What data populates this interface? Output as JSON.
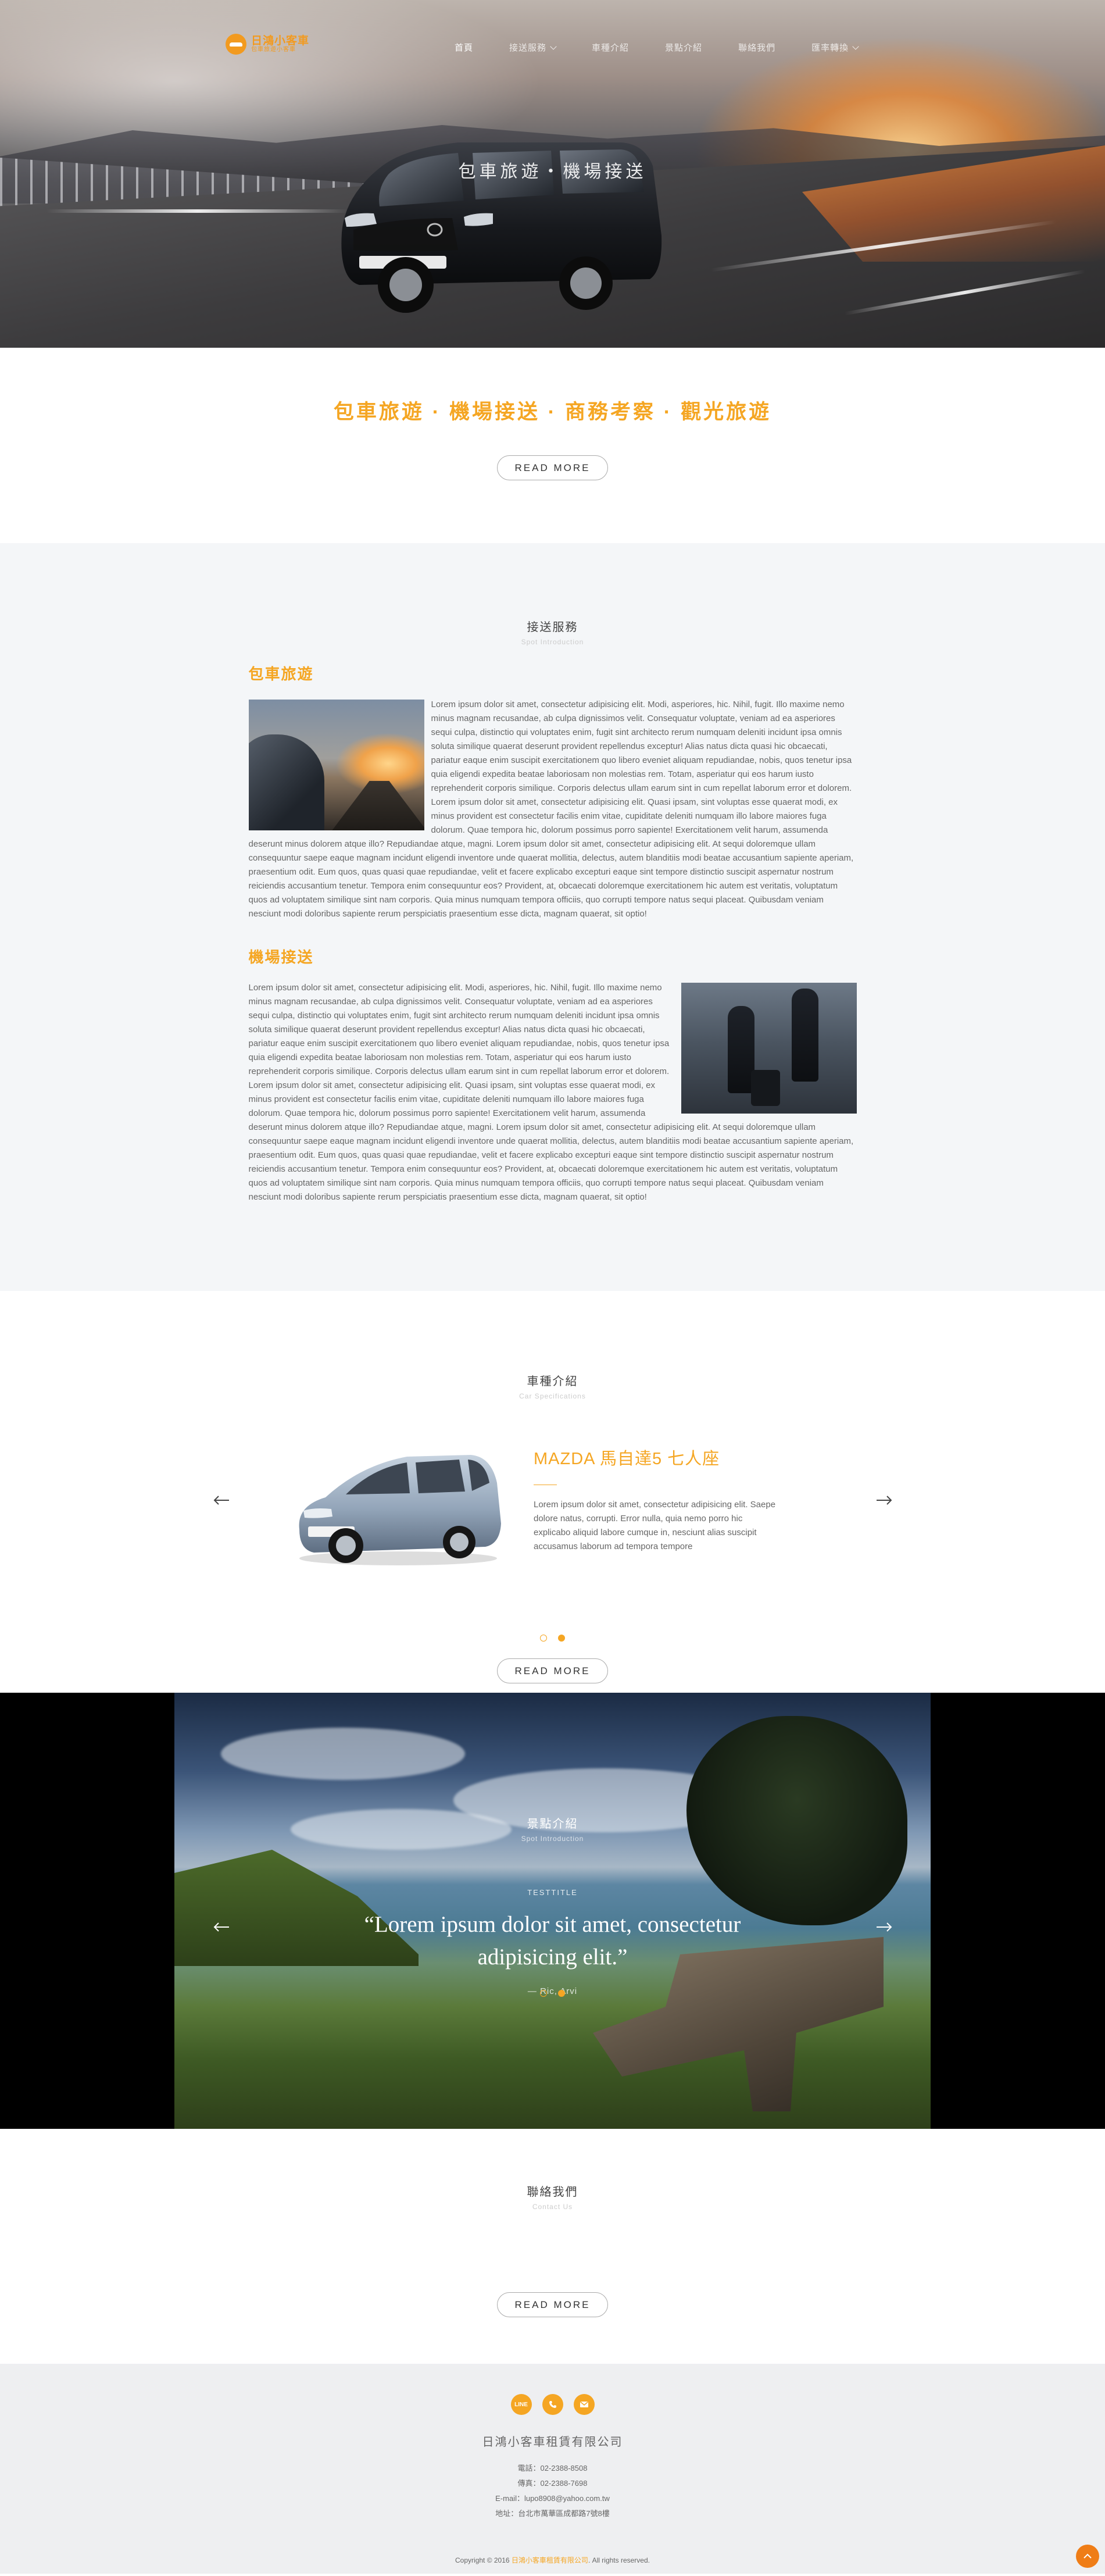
{
  "brand": {
    "name": "日鴻小客車",
    "tagline": "包車旅遊小客車",
    "accent": "#f5a623"
  },
  "nav": {
    "items": [
      {
        "label": "首頁",
        "dropdown": false,
        "active": true
      },
      {
        "label": "接送服務",
        "dropdown": true,
        "active": false
      },
      {
        "label": "車種介紹",
        "dropdown": false,
        "active": false
      },
      {
        "label": "景點介紹",
        "dropdown": false,
        "active": false
      },
      {
        "label": "聯絡我們",
        "dropdown": false,
        "active": false
      },
      {
        "label": "匯率轉換",
        "dropdown": true,
        "active": false
      }
    ]
  },
  "hero": {
    "caption": "包車旅遊・機場接送"
  },
  "intro": {
    "title": "包車旅遊 · 機場接送 · 商務考察 · 觀光旅遊",
    "button": "READ MORE"
  },
  "services": {
    "title": "接送服務",
    "subtitle": "Spot Introduction",
    "blocks": [
      {
        "heading": "包車旅遊",
        "image": "car-sunset-photo",
        "image_side": "left",
        "text": "Lorem ipsum dolor sit amet, consectetur adipisicing elit. Modi, asperiores, hic. Nihil, fugit. Illo maxime nemo minus magnam recusandae, ab culpa dignissimos velit. Consequatur voluptate, veniam ad ea asperiores sequi culpa, distinctio qui voluptates enim, fugit sint architecto rerum numquam deleniti incidunt ipsa omnis soluta similique quaerat deserunt provident repellendus exceptur! Alias natus dicta quasi hic obcaecati, pariatur eaque enim suscipit exercitationem quo libero eveniet aliquam repudiandae, nobis, quos tenetur ipsa quia eligendi expedita beatae laboriosam non molestias rem. Totam, asperiatur qui eos harum iusto reprehenderit corporis similique. Corporis delectus ullam earum sint in cum repellat laborum error et dolorem. Lorem ipsum dolor sit amet, consectetur adipisicing elit. Quasi ipsam, sint voluptas esse quaerat modi, ex minus provident est consectetur facilis enim vitae, cupiditate deleniti numquam illo labore maiores fuga dolorum. Quae tempora hic, dolorum possimus porro sapiente! Exercitationem velit harum, assumenda deserunt minus dolorem atque illo? Repudiandae atque, magni. Lorem ipsum dolor sit amet, consectetur adipisicing elit. At sequi doloremque ullam consequuntur saepe eaque magnam incidunt eligendi inventore unde quaerat mollitia, delectus, autem blanditiis modi beatae accusantium sapiente aperiam, praesentium odit. Eum quos, quas quasi quae repudiandae, velit et facere explicabo excepturi eaque sint tempore distinctio suscipit aspernatur nostrum reiciendis accusantium tenetur. Tempora enim consequuntur eos? Provident, at, obcaecati doloremque exercitationem hic autem est veritatis, voluptatum quos ad voluptatem similique sint nam corporis. Quia minus numquam tempora officiis, quo corrupti tempore natus sequi placeat. Quibusdam veniam nesciunt modi doloribus sapiente rerum perspiciatis praesentium esse dicta, magnam quaerat, sit optio!"
      },
      {
        "heading": "機場接送",
        "image": "airport-traveler-photo",
        "image_side": "right",
        "text": "Lorem ipsum dolor sit amet, consectetur adipisicing elit. Modi, asperiores, hic. Nihil, fugit. Illo maxime nemo minus magnam recusandae, ab culpa dignissimos velit. Consequatur voluptate, veniam ad ea asperiores sequi culpa, distinctio qui voluptates enim, fugit sint architecto rerum numquam deleniti incidunt ipsa omnis soluta similique quaerat deserunt provident repellendus exceptur! Alias natus dicta quasi hic obcaecati, pariatur eaque enim suscipit exercitationem quo libero eveniet aliquam repudiandae, nobis, quos tenetur ipsa quia eligendi expedita beatae laboriosam non molestias rem. Totam, asperiatur qui eos harum iusto reprehenderit corporis similique. Corporis delectus ullam earum sint in cum repellat laborum error et dolorem. Lorem ipsum dolor sit amet, consectetur adipisicing elit. Quasi ipsam, sint voluptas esse quaerat modi, ex minus provident est consectetur facilis enim vitae, cupiditate deleniti numquam illo labore maiores fuga dolorum. Quae tempora hic, dolorum possimus porro sapiente! Exercitationem velit harum, assumenda deserunt minus dolorem atque illo? Repudiandae atque, magni. Lorem ipsum dolor sit amet, consectetur adipisicing elit. At sequi doloremque ullam consequuntur saepe eaque magnam incidunt eligendi inventore unde quaerat mollitia, delectus, autem blanditiis modi beatae accusantium sapiente aperiam, praesentium odit. Eum quos, quas quasi quae repudiandae, velit et facere explicabo excepturi eaque sint tempore distinctio suscipit aspernatur nostrum reiciendis accusantium tenetur. Tempora enim consequuntur eos? Provident, at, obcaecati doloremque exercitationem hic autem est veritatis, voluptatum quos ad voluptatem similique sint nam corporis. Quia minus numquam tempora officiis, quo corrupti tempore natus sequi placeat. Quibusdam veniam nesciunt modi doloribus sapiente rerum perspiciatis praesentium esse dicta, magnam quaerat, sit optio!"
      }
    ]
  },
  "cars": {
    "title": "車種介紹",
    "subtitle": "Car Specifications",
    "current": {
      "name": "MAZDA 馬自達5 七人座",
      "desc": "Lorem ipsum dolor sit amet, consectetur adipisicing elit. Saepe dolore natus, corrupti. Error nulla, quia nemo porro hic explicabo aliquid labore cumque in, nesciunt alias suscipit accusamus laborum ad tempora tempore",
      "image": "mazda5-silver-photo"
    },
    "slides": 2,
    "active_slide": 2,
    "button": "READ MORE",
    "prev_icon": "arrow-left-icon",
    "next_icon": "arrow-right-icon"
  },
  "spots": {
    "title": "景點介紹",
    "subtitle": "Spot Introduction",
    "tag": "TESTTITLE",
    "quote": "“Lorem ipsum dolor sit amet, consectetur adipisicing elit.”",
    "author": "— Ric, Arvi",
    "slides": 2,
    "active_slide": 2,
    "image": "coastal-bench-landscape-photo"
  },
  "contact": {
    "title": "聯絡我們",
    "subtitle": "Contact Us",
    "button": "READ MORE"
  },
  "footer": {
    "icons": [
      {
        "name": "line-icon",
        "label": "LINE"
      },
      {
        "name": "phone-icon",
        "label": ""
      },
      {
        "name": "mail-icon",
        "label": ""
      }
    ],
    "company": "日鴻小客車租賃有限公司",
    "phone": "電話：02-2388-8508",
    "fax": "傳真：02-2388-7698",
    "email": "E-mail：lupo8908@yahoo.com.tw",
    "address": "地址：台北市萬華區成都路7號8樓",
    "copyright_prefix": "Copyright © 2016 ",
    "copyright_company": "日鴻小客車租賃有限公司",
    "copyright_suffix": ". All rights reserved."
  }
}
